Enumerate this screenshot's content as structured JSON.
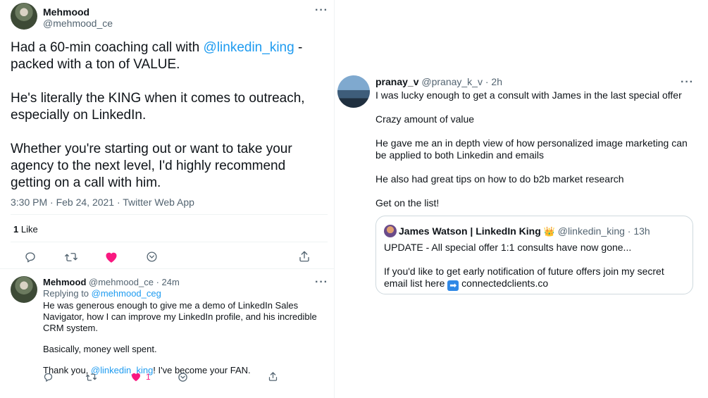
{
  "main_tweet": {
    "author_name": "Mehmood",
    "author_handle": "@mehmood_ce",
    "body": {
      "p1_before": "Had a 60-min coaching call with ",
      "p1_mention": "@linkedin_king",
      "p1_after": " - packed with a ton of VALUE.",
      "p2": "He's literally the KING when it comes to outreach, especially on LinkedIn.",
      "p3": "Whether you're starting out or want to take your agency to the next level, I'd highly recommend getting on a call with him."
    },
    "meta": "3:30 PM · Feb 24, 2021 · Twitter Web App",
    "likes_count": "1",
    "likes_label": " Like"
  },
  "reply": {
    "author_name": "Mehmood",
    "author_handle": "@mehmood_ce · 24m",
    "replying_to_prefix": "Replying to ",
    "replying_to_handle": "@mehmood_ceg",
    "p1": "He was generous enough to give me a demo of LinkedIn Sales Navigator, how I can improve my LinkedIn profile, and his incredible CRM system.",
    "p2": "Basically, money well spent.",
    "p3_before": "Thank you, ",
    "p3_mention": "@linkedin_king",
    "p3_after": "! I've become your FAN.",
    "like_count": "1"
  },
  "right_tweet": {
    "author_name": "pranay_v",
    "author_meta": "@pranay_k_v · 2h",
    "p1": "I was lucky enough to get a consult with James in the last special offer",
    "p2": "Crazy amount of value",
    "p3": "He gave me an in depth view of how personalized image marketing can be applied to both Linkedin and emails",
    "p4": "He also had great tips on how to do b2b market research",
    "p5": "Get on the list!"
  },
  "quoted_tweet": {
    "author_name": "James Watson | LinkedIn King",
    "crown": "👑",
    "author_meta": "@linkedin_king · 13h",
    "p1": "UPDATE - All special offer 1:1 consults have now gone...",
    "p2": "If you'd like to get early notification of future offers join my secret email list here",
    "arrow": "➡",
    "link_text": "connectedclients.co"
  },
  "icons": {
    "more": "more-dots-icon",
    "reply": "reply-icon",
    "retweet": "retweet-icon",
    "like": "heart-icon",
    "save": "save-icon",
    "share": "share-icon"
  },
  "colors": {
    "link": "#1d9bf0",
    "heart": "#f91880",
    "muted": "#536471",
    "border": "#cfd9de"
  }
}
